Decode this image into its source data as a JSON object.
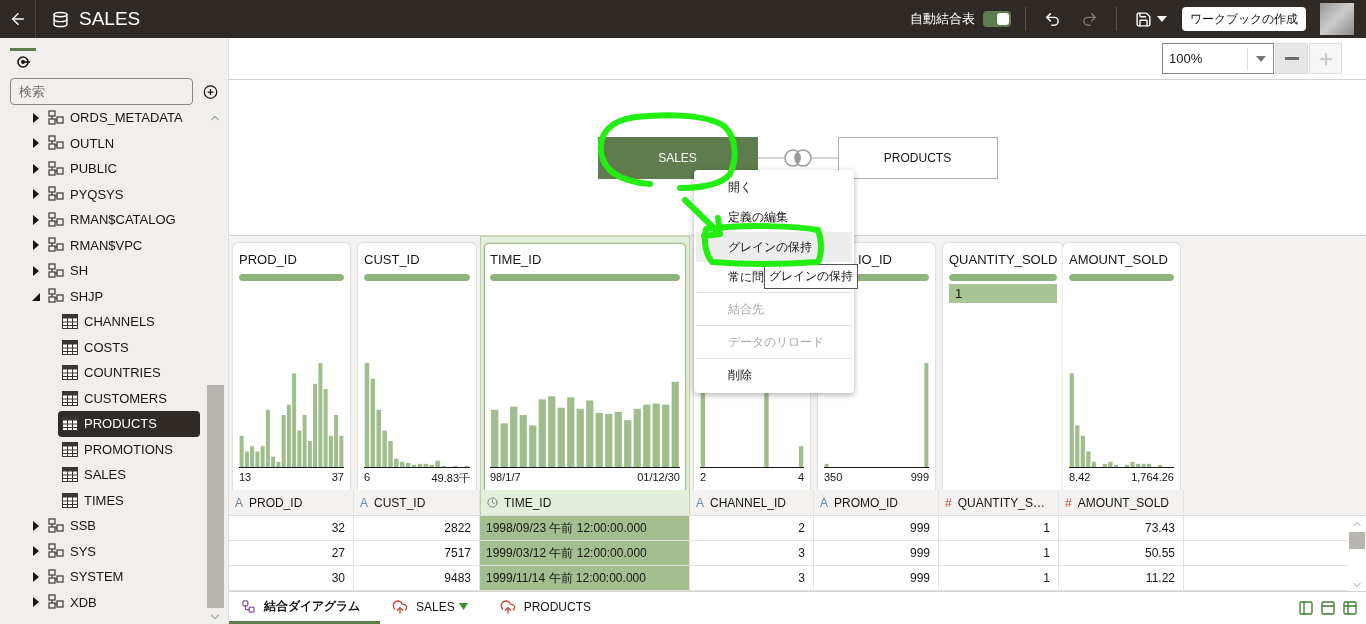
{
  "header": {
    "title": "SALES",
    "auto_join_label": "自動結合表",
    "auto_join_on": true,
    "redo_disabled": true,
    "create_button": "ワークブックの作成"
  },
  "sidebar": {
    "search": {
      "placeholder": "検索"
    },
    "tree": [
      {
        "label": "ORDS_METADATA",
        "kind": "schema",
        "expanded": false,
        "selected": false
      },
      {
        "label": "OUTLN",
        "kind": "schema",
        "expanded": false,
        "selected": false
      },
      {
        "label": "PUBLIC",
        "kind": "schema",
        "expanded": false,
        "selected": false
      },
      {
        "label": "PYQSYS",
        "kind": "schema",
        "expanded": false,
        "selected": false
      },
      {
        "label": "RMAN$CATALOG",
        "kind": "schema",
        "expanded": false,
        "selected": false
      },
      {
        "label": "RMAN$VPC",
        "kind": "schema",
        "expanded": false,
        "selected": false
      },
      {
        "label": "SH",
        "kind": "schema",
        "expanded": false,
        "selected": false
      },
      {
        "label": "SHJP",
        "kind": "schema",
        "expanded": true,
        "selected": false,
        "children": [
          {
            "label": "CHANNELS",
            "kind": "table",
            "selected": false
          },
          {
            "label": "COSTS",
            "kind": "table",
            "selected": false
          },
          {
            "label": "COUNTRIES",
            "kind": "table",
            "selected": false
          },
          {
            "label": "CUSTOMERS",
            "kind": "table",
            "selected": false
          },
          {
            "label": "PRODUCTS",
            "kind": "table",
            "selected": true
          },
          {
            "label": "PROMOTIONS",
            "kind": "table",
            "selected": false
          },
          {
            "label": "SALES",
            "kind": "table",
            "selected": false
          },
          {
            "label": "TIMES",
            "kind": "table",
            "selected": false
          }
        ]
      },
      {
        "label": "SSB",
        "kind": "schema",
        "expanded": false,
        "selected": false
      },
      {
        "label": "SYS",
        "kind": "schema",
        "expanded": false,
        "selected": false
      },
      {
        "label": "SYSTEM",
        "kind": "schema",
        "expanded": false,
        "selected": false
      },
      {
        "label": "XDB",
        "kind": "schema",
        "expanded": false,
        "selected": false
      }
    ]
  },
  "zoom": {
    "value": "100%",
    "zoom_out_disabled": false,
    "zoom_in_disabled": true
  },
  "diagram": {
    "nodes": [
      {
        "label": "SALES",
        "selected": true
      },
      {
        "label": "PRODUCTS",
        "selected": false
      }
    ]
  },
  "context_menu": {
    "items": [
      {
        "label": "開く",
        "disabled": false,
        "highlighted": false,
        "separated": false
      },
      {
        "label": "定義の編集",
        "disabled": false,
        "highlighted": false,
        "separated": false
      },
      {
        "label": "グレインの保持",
        "disabled": false,
        "highlighted": true,
        "separated": false
      },
      {
        "label": "常に問",
        "disabled": false,
        "highlighted": false,
        "separated": false
      },
      {
        "label": "結合先",
        "disabled": true,
        "highlighted": false,
        "separated": true
      },
      {
        "label": "データのリロード",
        "disabled": true,
        "highlighted": false,
        "separated": true
      },
      {
        "label": "削除",
        "disabled": false,
        "highlighted": false,
        "separated": true
      }
    ]
  },
  "tooltip": {
    "text": "グレインの保持"
  },
  "profiles": [
    {
      "title": "PROD_ID",
      "kind": "histogram",
      "level": 1,
      "min": "13",
      "max": "37",
      "selected": false
    },
    {
      "title": "CUST_ID",
      "kind": "histogram",
      "level": 1,
      "min": "6",
      "max": "49.83千",
      "selected": false
    },
    {
      "title": "TIME_ID",
      "kind": "histogram",
      "level": 1,
      "min": "98/1/7",
      "max": "01/12/30",
      "selected": true
    },
    {
      "kind": "histogram",
      "min": "2",
      "max": "4",
      "selected": false
    },
    {
      "title": "IO_ID",
      "covered": true,
      "kind": "histogram",
      "level": 1,
      "min": "350",
      "max": "999",
      "selected": false
    },
    {
      "title": "QUANTITY_SOLD",
      "kind": "values",
      "level": 1,
      "values": [
        "1"
      ],
      "selected": false
    },
    {
      "title": "AMOUNT_SOLD",
      "kind": "histogram",
      "level": 1,
      "min": "8.42",
      "max": "1,764.26",
      "selected": false
    }
  ],
  "table": {
    "columns": [
      {
        "name": "PROD_ID",
        "kind": "text",
        "glyph": "A",
        "selected": false
      },
      {
        "name": "CUST_ID",
        "kind": "text",
        "glyph": "A",
        "selected": false
      },
      {
        "name": "TIME_ID",
        "kind": "time",
        "selected": true
      },
      {
        "name": "CHANNEL_ID",
        "kind": "text",
        "glyph": "A",
        "selected": false
      },
      {
        "name": "PROMO_ID",
        "kind": "text",
        "glyph": "A",
        "selected": false
      },
      {
        "name": "QUANTITY_S…",
        "kind": "number",
        "glyph": "#",
        "selected": false
      },
      {
        "name": "AMOUNT_SOLD",
        "kind": "number",
        "glyph": "#",
        "selected": false
      }
    ],
    "rows": [
      [
        "32",
        "2822",
        "1998/09/23 午前 12:00:00.000",
        "2",
        "999",
        "1",
        "73.43"
      ],
      [
        "27",
        "7517",
        "1999/03/12 午前 12:00:00.000",
        "3",
        "999",
        "1",
        "50.55"
      ],
      [
        "30",
        "9483",
        "1999/11/14 午前 12:00:00.000",
        "3",
        "999",
        "1",
        "11.22"
      ]
    ]
  },
  "bottom_tabs": [
    {
      "label": "結合ダイアグラム",
      "kind": "diagram",
      "selected": true,
      "menu": false
    },
    {
      "label": "SALES",
      "kind": "source",
      "selected": false,
      "menu": true
    },
    {
      "label": "PRODUCTS",
      "kind": "source",
      "selected": false,
      "menu": false
    }
  ]
}
